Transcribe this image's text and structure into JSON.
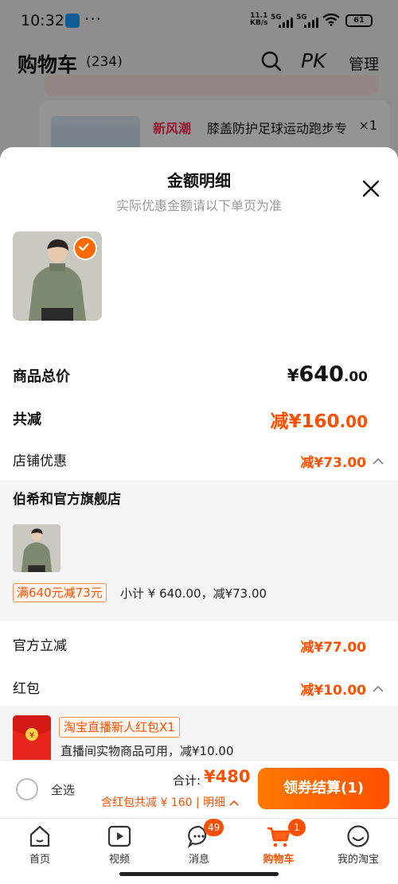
{
  "status_bar": {
    "time": "10:32",
    "speed_top": "11.1",
    "speed_bottom": "KB/s",
    "sig1": "5G",
    "sig2": "5G",
    "battery": "61"
  },
  "header": {
    "title": "购物车",
    "count": "(234)",
    "pk": "PK",
    "manage": "管理"
  },
  "background": {
    "item_tag": "新风潮",
    "item_name": "膝盖防护足球运动跑步专",
    "item_qty": "×1"
  },
  "sheet": {
    "title": "金额明细",
    "subtitle": "实际优惠金额请以下单页为准",
    "total_label": "商品总价",
    "total_currency": "¥",
    "total_int": "640",
    "total_dec": ".00",
    "reduce_label": "共减",
    "reduce_value": "减¥160",
    "reduce_dec": ".00",
    "shop_discount_label": "店铺优惠",
    "shop_discount_value": "减¥73.00",
    "shop_name": "伯希和官方旗舰店",
    "coupon_tag": "满640元减73元",
    "subtotal": "小计 ¥ 640.00，减¥73.00",
    "official_label": "官方立减",
    "official_value": "减¥77.00",
    "redpack_label": "红包",
    "redpack_value": "减¥10.00",
    "redpack_tag": "淘宝直播新人红包X1",
    "redpack_desc": "直播间实物商品可用，减¥10.00"
  },
  "checkout": {
    "select_all": "全选",
    "sum_label": "合计:",
    "sum_value": "¥480",
    "sum_sub": "含红包共减 ¥ 160 | 明细",
    "button": "领券结算(1)"
  },
  "tabs": [
    {
      "label": "首页",
      "icon": "home-icon"
    },
    {
      "label": "视频",
      "icon": "video-icon"
    },
    {
      "label": "消息",
      "icon": "message-icon",
      "badge": "49"
    },
    {
      "label": "购物车",
      "icon": "cart-icon",
      "badge": "1"
    },
    {
      "label": "我的淘宝",
      "icon": "profile-icon"
    }
  ],
  "colors": {
    "accent": "#ff5000",
    "promo_red": "#ff2d55"
  }
}
